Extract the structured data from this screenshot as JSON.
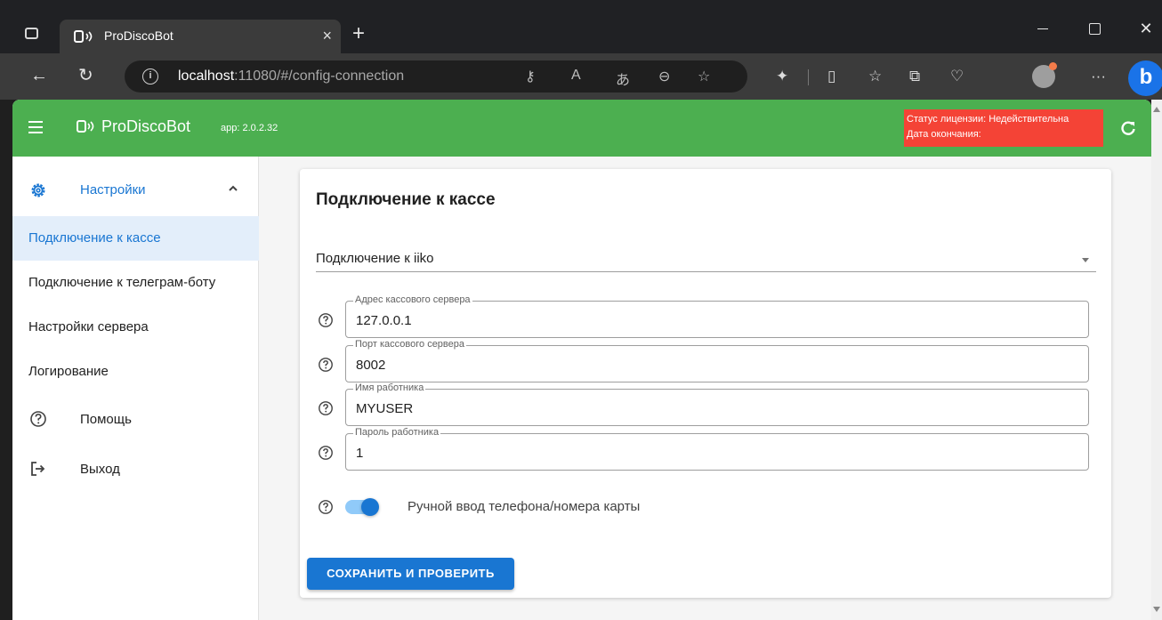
{
  "browser": {
    "tab_title": "ProDiscoBot",
    "tab_close": "×",
    "new_tab": "+",
    "url_host": "localhost",
    "url_rest": ":11080/#/config-connection",
    "info_glyph": "i",
    "window_close": "✕"
  },
  "app": {
    "brand": "ProDiscoBot",
    "version": "app: 2.0.2.32",
    "license_status": "Статус лицензии: Недействительна",
    "license_end": "Дата окончания:",
    "colors": {
      "appbar": "#4caf50",
      "license": "#f44336",
      "accent": "#1976d2"
    }
  },
  "sidebar": {
    "group_label": "Настройки",
    "items": [
      {
        "label": "Подключение к кассе"
      },
      {
        "label": "Подключение к телеграм-боту"
      },
      {
        "label": "Настройки сервера"
      },
      {
        "label": "Логирование"
      },
      {
        "label": "Помощь",
        "icon": "help-icon"
      },
      {
        "label": "Выход",
        "icon": "logout-icon"
      }
    ]
  },
  "main": {
    "title": "Подключение к кассе",
    "connection_type": "Подключение к iiko",
    "fields": [
      {
        "label": "Адрес кассового сервера",
        "value": "127.0.0.1"
      },
      {
        "label": "Порт кассового сервера",
        "value": "8002"
      },
      {
        "label": "Имя работника",
        "value": "MYUSER"
      },
      {
        "label": "Пароль работника",
        "value": "1"
      }
    ],
    "toggle_label": "Ручной ввод телефона/номера карты",
    "toggle_on": true,
    "save_button": "СОХРАНИТЬ И ПРОВЕРИТЬ"
  }
}
